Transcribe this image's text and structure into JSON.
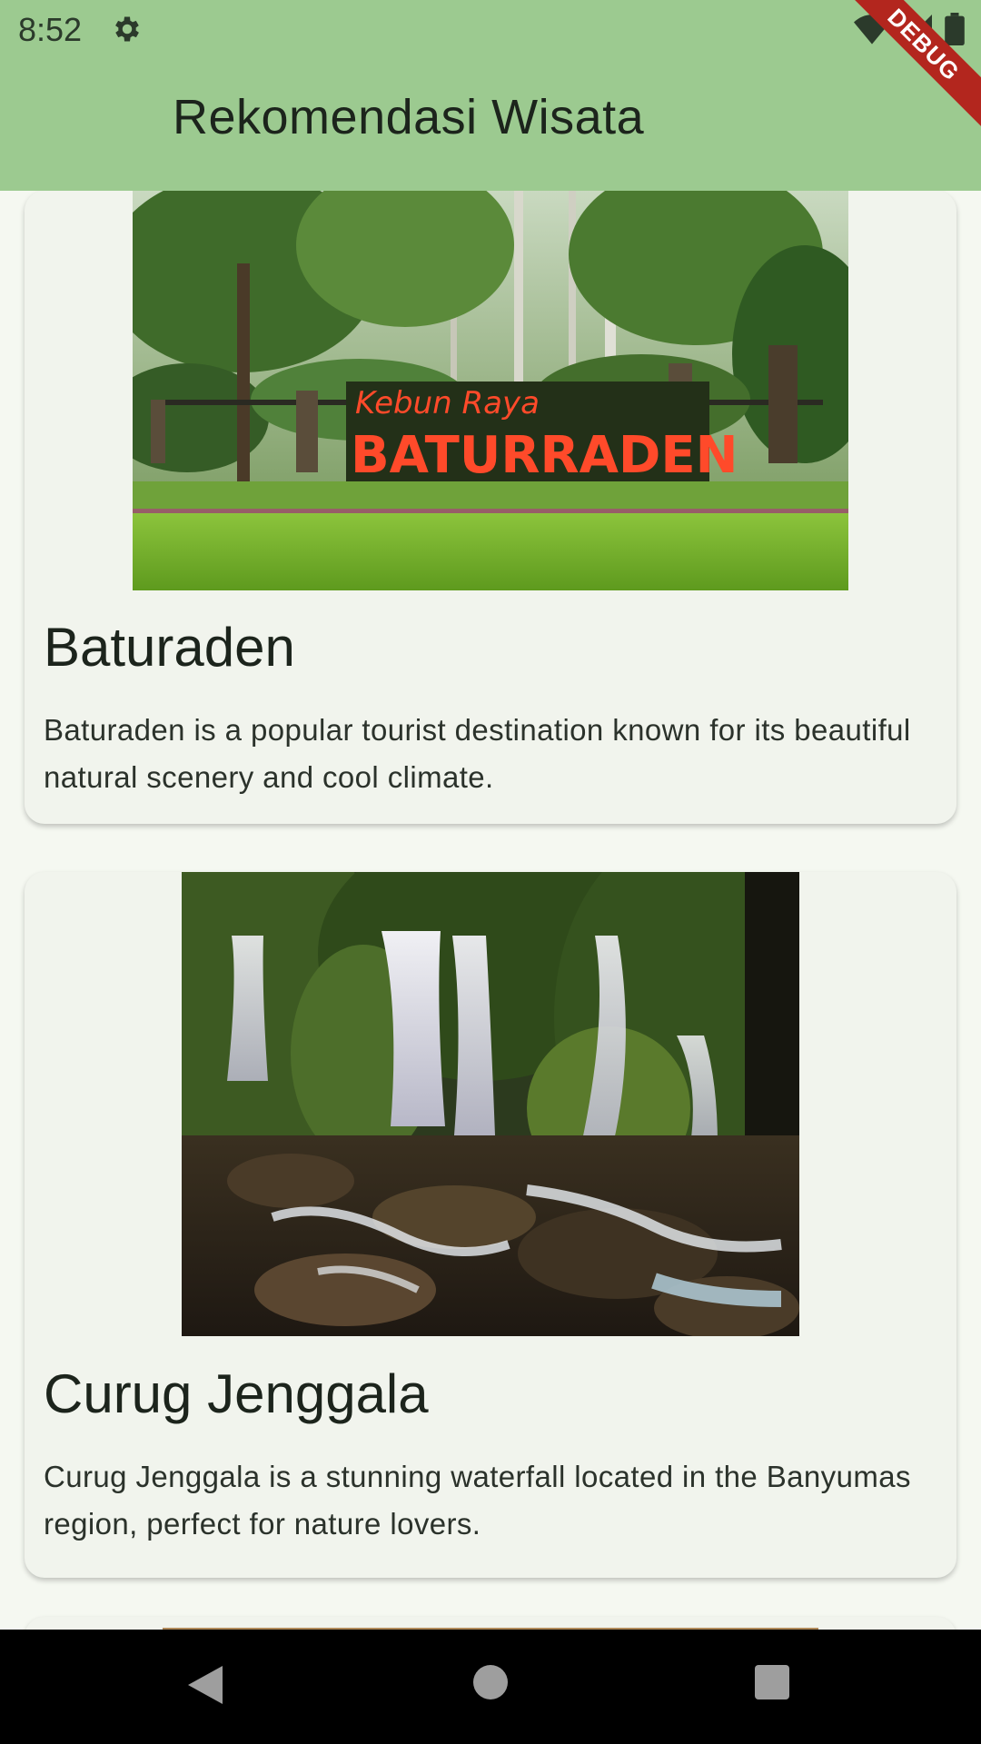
{
  "status_bar": {
    "time": "8:52",
    "icons": [
      "gear-icon",
      "wifi-icon",
      "signal-icon",
      "battery-icon"
    ]
  },
  "app_bar": {
    "title": "Rekomendasi Wisata",
    "background_color": "#9cca90"
  },
  "debug_banner": "DEBUG",
  "cards": [
    {
      "title": "Baturaden",
      "description": "Baturaden is a popular tourist destination known for its beautiful natural scenery and cool climate.",
      "image_sign_line1": "Kebun Raya",
      "image_sign_line2": "BATURRADEN"
    },
    {
      "title": "Curug Jenggala",
      "description": "Curug Jenggala is a stunning waterfall located in the Banyumas region, perfect for nature lovers."
    }
  ],
  "nav_bar": {
    "buttons": [
      "back-icon",
      "home-icon",
      "recents-icon"
    ]
  }
}
